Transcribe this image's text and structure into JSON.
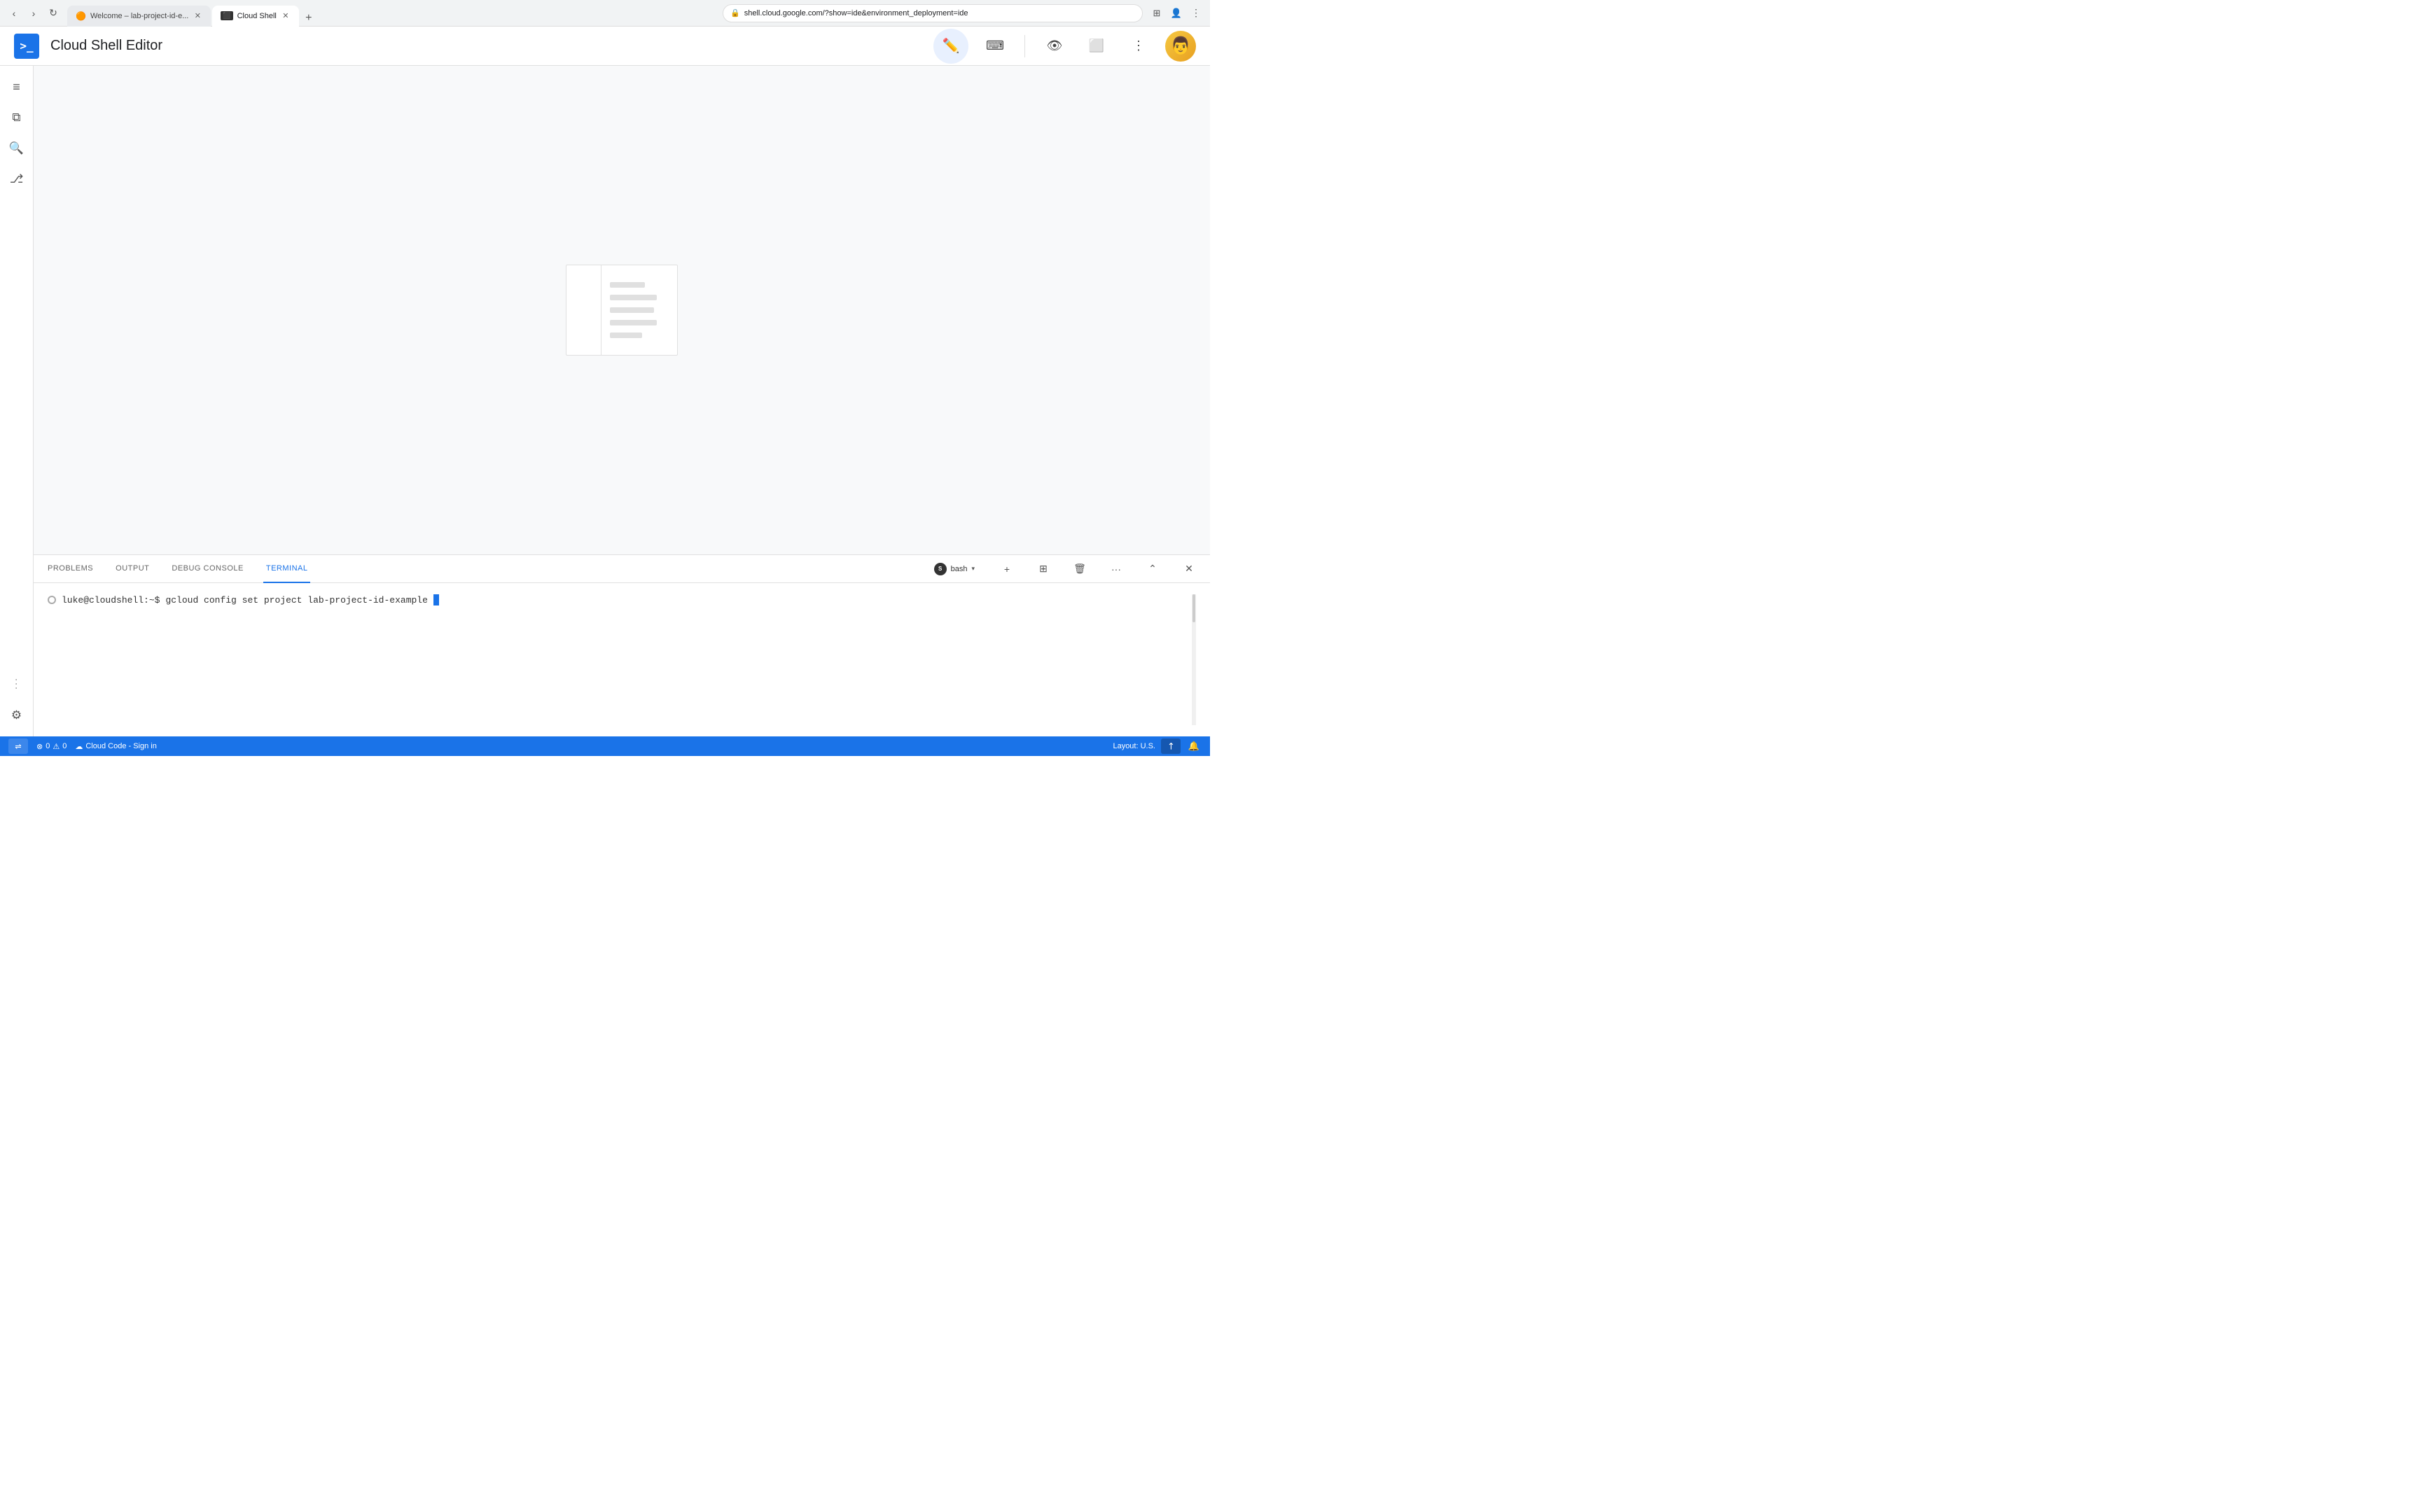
{
  "browser": {
    "tabs": [
      {
        "id": "tab1",
        "title": "Welcome – lab-project-id-e...",
        "favicon": "🟠",
        "active": false
      },
      {
        "id": "tab2",
        "title": "Cloud Shell",
        "favicon": "⬛",
        "active": true
      }
    ],
    "address": "shell.cloud.google.com/?show=ide&environment_deployment=ide"
  },
  "header": {
    "logo_symbol": ">_",
    "title": "Cloud Shell Editor",
    "pencil_btn_label": "Edit",
    "terminal_btn_label": "Open Terminal",
    "preview_btn_label": "Web Preview",
    "split_btn_label": "Split Editor",
    "more_btn_label": "More Options"
  },
  "sidebar": {
    "menu_icon": "☰",
    "copy_icon": "⧉",
    "search_icon": "🔍",
    "git_icon": "⎇",
    "more_dots": "···",
    "settings_icon": "⚙"
  },
  "terminal": {
    "tabs": [
      {
        "id": "problems",
        "label": "PROBLEMS",
        "active": false
      },
      {
        "id": "output",
        "label": "OUTPUT",
        "active": false
      },
      {
        "id": "debug",
        "label": "DEBUG CONSOLE",
        "active": false
      },
      {
        "id": "terminal",
        "label": "TERMINAL",
        "active": true
      }
    ],
    "bash_label": "bash",
    "prompt": "luke@cloudshell:~$",
    "command": "gcloud config set project lab-project-id-example",
    "actions": {
      "new_terminal": "+",
      "split_terminal": "⊞",
      "kill_terminal": "🗑",
      "more": "···",
      "maximize": "⌃",
      "close": "✕"
    }
  },
  "status_bar": {
    "toggle_label": "⇌",
    "errors": "0",
    "warnings": "0",
    "cloud_code_label": "Cloud Code - Sign in",
    "layout_label": "Layout: U.S.",
    "bell_label": "🔔"
  },
  "placeholder_lines": [
    {
      "width": "60%"
    },
    {
      "width": "80%"
    },
    {
      "width": "75%"
    },
    {
      "width": "80%"
    },
    {
      "width": "55%"
    }
  ]
}
